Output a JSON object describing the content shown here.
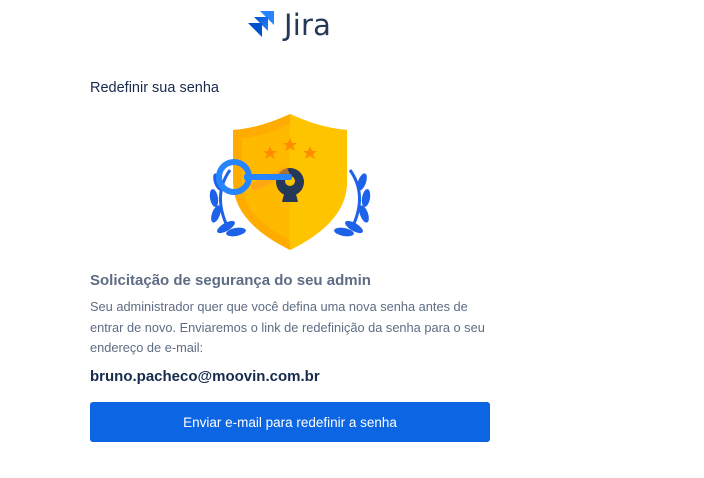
{
  "brand": {
    "logo_icon": "jira-logo-icon",
    "name": "Jira",
    "accent_color": "#0c66e4"
  },
  "page": {
    "title": "Redefinir sua senha"
  },
  "illustration": {
    "icon": "shield-key-icon"
  },
  "security_request": {
    "heading": "Solicitação de segurança do seu admin",
    "description": "Seu administrador quer que você defina uma nova senha antes de entrar de novo. Enviaremos o link de redefinição da senha para o seu endereço de e-mail:",
    "email": "bruno.pacheco@moovin.com.br"
  },
  "actions": {
    "send_reset_email_label": "Enviar e-mail para redefinir a senha"
  }
}
